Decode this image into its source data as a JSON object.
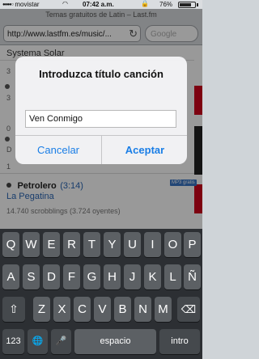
{
  "status_bar": {
    "carrier": "movistar",
    "time": "07:42 a.m.",
    "battery_percent": "76%",
    "battery_level": 0.76,
    "signal_icon": "signal-bars-icon",
    "wifi_icon": "wifi-icon",
    "lock_icon": "orientation-lock-icon"
  },
  "browser": {
    "page_title": "Temas gratuitos de Latin – Last.fm",
    "url": "http://www.lastfm.es/music/...",
    "reload_icon": "reload-icon",
    "search_placeholder": "Google"
  },
  "page": {
    "partial_row": "Systema Solar",
    "side_numbers": [
      "3",
      "3",
      "0",
      "D",
      "1"
    ],
    "track": {
      "name": "Petrolero",
      "duration": "(3:14)",
      "badge": "MP3 gratis",
      "artist": "La Pegatina",
      "scrobbles": "14.740 scrobblings (3.724 oyentes)"
    }
  },
  "alert": {
    "title": "Introduzca título canción",
    "input_value": "Ven Conmigo",
    "cancel_label": "Cancelar",
    "accept_label": "Aceptar"
  },
  "keyboard": {
    "row1": [
      "Q",
      "W",
      "E",
      "R",
      "T",
      "Y",
      "U",
      "I",
      "O",
      "P"
    ],
    "row2": [
      "A",
      "S",
      "D",
      "F",
      "G",
      "H",
      "J",
      "K",
      "L",
      "Ñ"
    ],
    "row3": [
      "Z",
      "X",
      "C",
      "V",
      "B",
      "N",
      "M"
    ],
    "shift_icon": "⇧",
    "delete_icon": "⌫",
    "numbers_label": "123",
    "globe_icon": "🌐",
    "mic_icon": "🎤",
    "space_label": "espacio",
    "return_label": "intro"
  },
  "colors": {
    "accent": "#1a7ee6",
    "keyboard_bg": "#2c2f33",
    "key_bg": "#5c6064"
  }
}
